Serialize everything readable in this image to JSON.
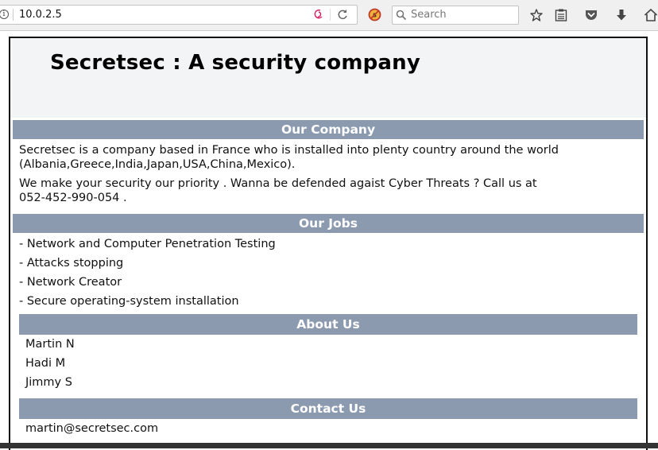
{
  "browser": {
    "url": "10.0.2.5",
    "search_placeholder": "Search",
    "icons": [
      "info-icon",
      "debian-icon",
      "reload-icon",
      "noscript-icon",
      "search-icon",
      "bookmark-star-icon",
      "reading-list-icon",
      "pocket-icon",
      "download-icon",
      "home-icon"
    ]
  },
  "page": {
    "title": "Secretsec : A security company",
    "company": {
      "heading": "Our Company",
      "para1_line1": "Secretsec is a company based in France who is installed into plenty country around the world",
      "para1_line2": "(Albania,Greece,India,Japan,USA,China,Mexico).",
      "para2_line1": "We make your security our priority . Wanna be defended agaist Cyber Threats ? Call us at",
      "para2_line2": "052-452-990-054 ."
    },
    "jobs": {
      "heading": "Our Jobs",
      "items": [
        "- Network and Computer Penetration Testing",
        "- Attacks stopping",
        "- Network Creator",
        "- Secure operating-system installation"
      ]
    },
    "about": {
      "heading": "About Us",
      "members": [
        "Martin N",
        "Hadi M",
        "Jimmy S"
      ]
    },
    "contact": {
      "heading": "Contact Us",
      "email": "martin@secretsec.com"
    }
  },
  "colors": {
    "section_header_bg": "#8c9ab0",
    "header_band_bg": "#f3f4f6"
  }
}
